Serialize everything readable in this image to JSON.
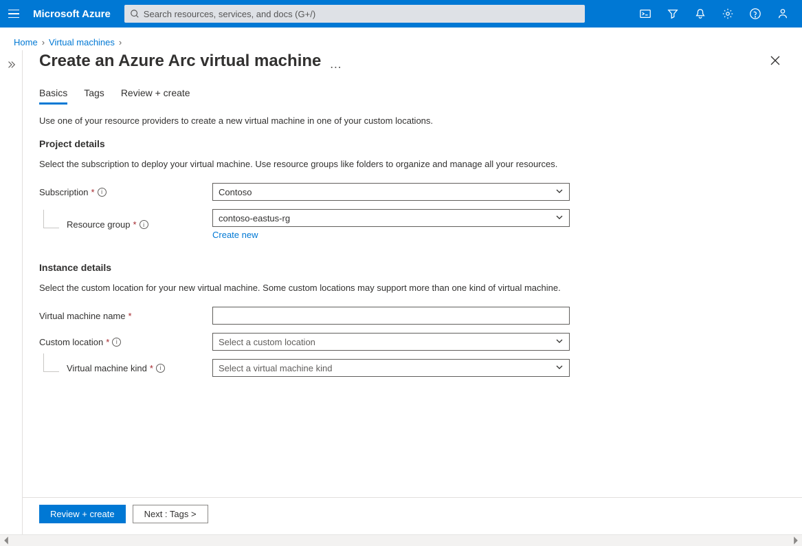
{
  "header": {
    "brand": "Microsoft Azure",
    "search_placeholder": "Search resources, services, and docs (G+/)"
  },
  "breadcrumb": {
    "items": [
      "Home",
      "Virtual machines"
    ]
  },
  "page": {
    "title": "Create an Azure Arc virtual machine"
  },
  "tabs": [
    {
      "label": "Basics",
      "active": true
    },
    {
      "label": "Tags",
      "active": false
    },
    {
      "label": "Review + create",
      "active": false
    }
  ],
  "sections": {
    "intro": "Use one of your resource providers to create a new virtual machine in one of your custom locations.",
    "project": {
      "heading": "Project details",
      "desc": "Select the subscription to deploy your virtual machine. Use resource groups like folders to organize and manage all your resources.",
      "subscription_label": "Subscription",
      "subscription_value": "Contoso",
      "resource_group_label": "Resource group",
      "resource_group_value": "contoso-eastus-rg",
      "create_new": "Create new"
    },
    "instance": {
      "heading": "Instance details",
      "desc": "Select the custom location for your new virtual machine. Some custom locations may support more than one kind of virtual machine.",
      "vm_name_label": "Virtual machine name",
      "vm_name_value": "",
      "custom_location_label": "Custom location",
      "custom_location_placeholder": "Select a custom location",
      "vm_kind_label": "Virtual machine kind",
      "vm_kind_placeholder": "Select a virtual machine kind"
    }
  },
  "footer": {
    "review": "Review + create",
    "next": "Next : Tags >"
  }
}
